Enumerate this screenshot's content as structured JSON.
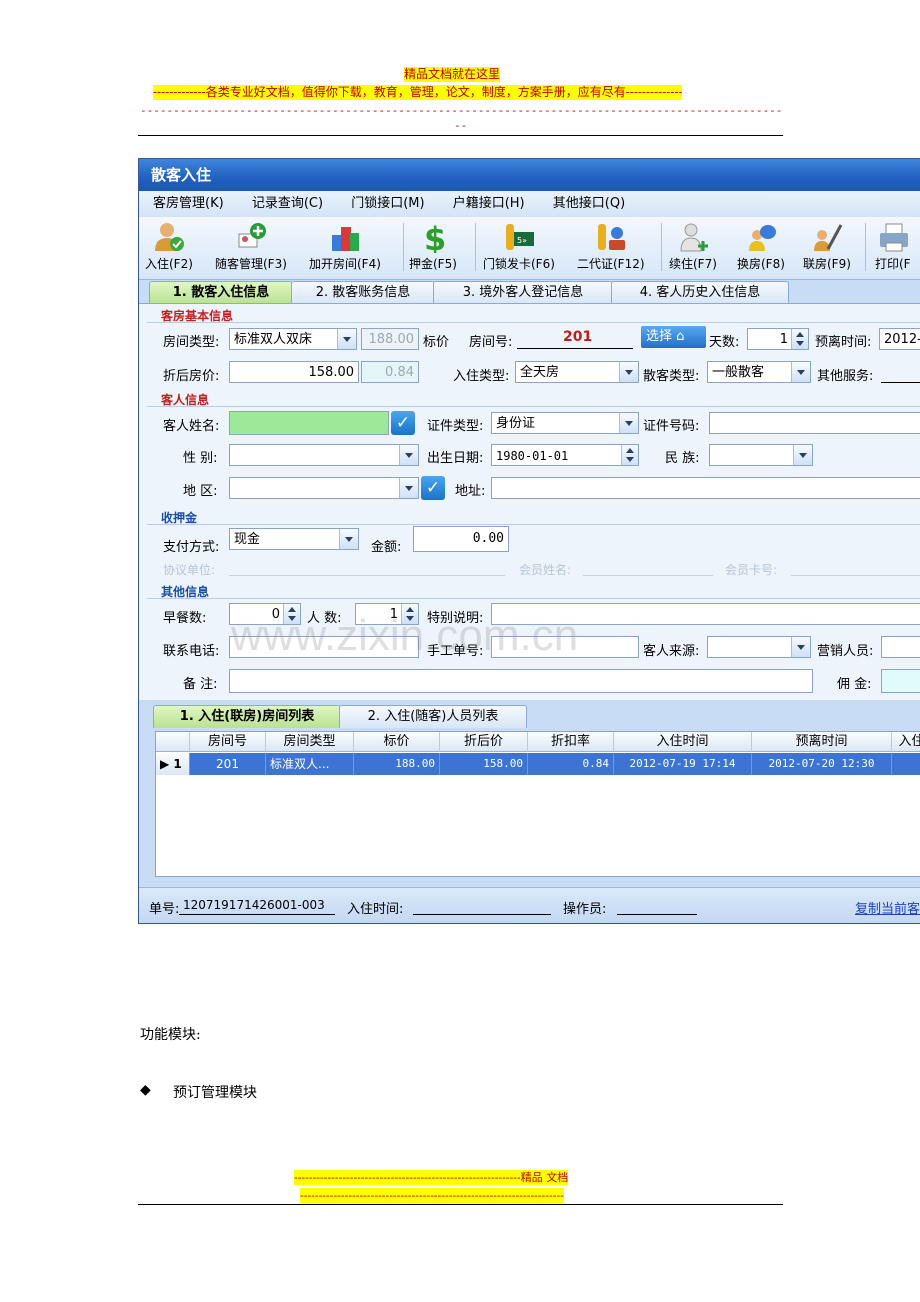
{
  "header": {
    "title": "精品文档就在这里",
    "tagline": "-------------各类专业好文档，值得你下载，教育，管理，论文，制度，方案手册，应有尽有--------------",
    "dash_line": "------------------------------------------------------------------------------------------------------------------------------",
    "dash_tail": "--"
  },
  "window": {
    "title": "散客入住",
    "menu": [
      "客房管理(K)",
      "记录查询(C)",
      "门锁接口(M)",
      "户籍接口(H)",
      "其他接口(Q)"
    ],
    "toolbar": [
      {
        "label": "入住(F2)",
        "icon": "person-check-icon"
      },
      {
        "label": "随客管理(F3)",
        "icon": "add-guest-icon"
      },
      {
        "label": "加开房间(F4)",
        "icon": "buildings-icon"
      },
      {
        "label": "押金(F5)",
        "icon": "dollar-icon"
      },
      {
        "label": "门锁发卡(F6)",
        "icon": "key-card-icon"
      },
      {
        "label": "二代证(F12)",
        "icon": "id-card-key-icon"
      },
      {
        "label": "续住(F7)",
        "icon": "person-add-icon"
      },
      {
        "label": "换房(F8)",
        "icon": "person-swap-icon"
      },
      {
        "label": "联房(F9)",
        "icon": "link-rooms-icon"
      },
      {
        "label": "打印(F",
        "icon": "printer-icon"
      }
    ],
    "tabs": [
      "1. 散客入住信息",
      "2. 散客账务信息",
      "3. 境外客人登记信息",
      "4. 客人历史入住信息"
    ],
    "sections": {
      "room": "客房基本信息",
      "guest": "客人信息",
      "deposit": "收押金",
      "other": "其他信息"
    },
    "room": {
      "room_type_label": "房间类型:",
      "room_type": "标准双人双床",
      "std_price": "188.00",
      "std_price_label": "标价",
      "room_no_label": "房间号:",
      "room_no": "201",
      "select_button": "选择",
      "days_label": "天数:",
      "days": "1",
      "leave_label": "预离时间:",
      "leave_value": "2012-",
      "disc_price_label": "折后房价:",
      "disc_price": "158.00",
      "disc_rate": "0.84",
      "checkin_type_label": "入住类型:",
      "checkin_type": "全天房",
      "guest_type_label": "散客类型:",
      "guest_type": "一般散客",
      "other_service_label": "其他服务:"
    },
    "guest": {
      "name_label": "客人姓名:",
      "id_type_label": "证件类型:",
      "id_type": "身份证",
      "id_no_label": "证件号码:",
      "gender_label": "性  别:",
      "birth_label": "出生日期:",
      "birth": "1980-01-01",
      "ethnic_label": "民  族:",
      "region_label": "地  区:",
      "address_label": "地址:"
    },
    "deposit": {
      "pay_label": "支付方式:",
      "pay": "现金",
      "amount_label": "金额:",
      "amount": "0.00",
      "agreement_label": "协议单位:",
      "member_name_label": "会员姓名:",
      "member_card_label": "会员卡号:"
    },
    "other": {
      "breakfast_label": "早餐数:",
      "breakfast": "0",
      "people_label": "人  数:",
      "people": "1",
      "special_label": "特别说明:",
      "phone_label": "联系电话:",
      "manual_label": "手工单号:",
      "source_label": "客人来源:",
      "sales_label": "营销人员:",
      "remark_label": "备  注:",
      "commission_label": "佣  金:"
    },
    "subtabs": [
      "1. 入住(联房)房间列表",
      "2. 入住(随客)人员列表"
    ],
    "grid": {
      "columns": [
        "房间号",
        "房间类型",
        "标价",
        "折后价",
        "折扣率",
        "入住时间",
        "预离时间",
        "入住"
      ],
      "rows": [
        {
          "marker": "▶ 1",
          "room": "201",
          "type": "标准双人...",
          "price": "188.00",
          "disc": "158.00",
          "rate": "0.84",
          "in": "2012-07-19 17:14",
          "out": "2012-07-20 12:30"
        }
      ]
    },
    "status": {
      "order_label": "单号:",
      "order_no": "120719171426001-003",
      "checkin_time_label": "入住时间:",
      "operator_label": "操作员:",
      "copy_link": "复制当前客"
    },
    "watermark": "www.zixin.com.cn"
  },
  "doc": {
    "modules_heading": "功能模块:",
    "bullet": "◆",
    "bullet_item": "预订管理模块"
  },
  "footer": {
    "line1": "-------------------------------------------------------------精品   文档",
    "line2": "-----------------------------------------------------------------------"
  },
  "colors": {
    "highlight": "#ffff00",
    "header_text": "#c00000",
    "title_bar": "#2060c0",
    "row_selected": "#3d74d4"
  }
}
